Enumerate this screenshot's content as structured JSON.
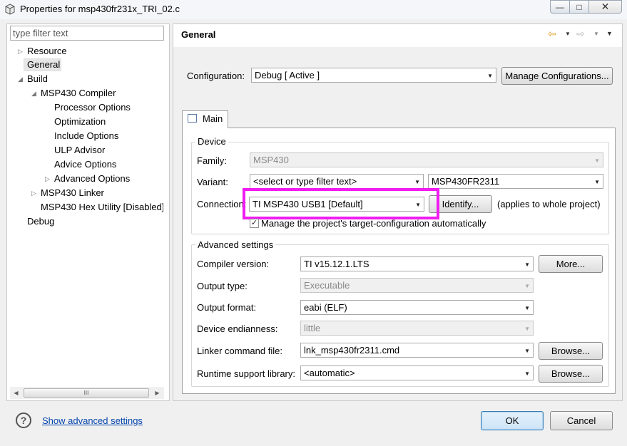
{
  "window": {
    "title": "Properties for msp430fr231x_TRI_02.c",
    "min": "—",
    "max": "□",
    "close": "✕"
  },
  "left": {
    "filter_placeholder": "type filter text",
    "tree": [
      {
        "label": "Resource",
        "arrow": "▷"
      },
      {
        "label": "General"
      },
      {
        "label": "Build",
        "arrow": "◢"
      },
      {
        "label": "MSP430 Compiler",
        "arrow": "◢"
      },
      {
        "label": "Processor Options"
      },
      {
        "label": "Optimization"
      },
      {
        "label": "Include Options"
      },
      {
        "label": "ULP Advisor"
      },
      {
        "label": "Advice Options"
      },
      {
        "label": "Advanced Options",
        "arrow": "▷"
      },
      {
        "label": "MSP430 Linker",
        "arrow": "▷"
      },
      {
        "label": "MSP430 Hex Utility  [Disabled]"
      },
      {
        "label": "Debug"
      }
    ],
    "scroll_thumb": "III"
  },
  "header": {
    "title": "General"
  },
  "config": {
    "label": "Configuration:",
    "value": "Debug  [ Active ]",
    "manage_label": "Manage Configurations..."
  },
  "tab": {
    "label": "Main"
  },
  "device": {
    "group_label": "Device",
    "family_label": "Family:",
    "family_value": "MSP430",
    "variant_label": "Variant:",
    "variant_filter": "<select or type filter text>",
    "variant_value": "MSP430FR2311",
    "connection_label": "Connection:",
    "connection_value": "TI MSP430 USB1 [Default]",
    "identify_label": "Identify...",
    "applies_note": "(applies to whole project)",
    "manage_checkbox_label": "Manage the project's target-configuration automatically",
    "manage_checked": "✓"
  },
  "advanced": {
    "group_label": "Advanced settings",
    "compiler_version_label": "Compiler version:",
    "compiler_version_value": "TI v15.12.1.LTS",
    "more_label": "More...",
    "output_type_label": "Output type:",
    "output_type_value": "Executable",
    "output_format_label": "Output format:",
    "output_format_value": "eabi (ELF)",
    "endianness_label": "Device endianness:",
    "endianness_value": "little",
    "linker_cmd_label": "Linker command file:",
    "linker_cmd_value": "lnk_msp430fr2311.cmd",
    "browse_label": "Browse...",
    "runtime_label": "Runtime support library:",
    "runtime_value": "<automatic>",
    "browse2_label": "Browse..."
  },
  "footer": {
    "help": "?",
    "advanced_link": "Show advanced settings",
    "ok": "OK",
    "cancel": "Cancel"
  },
  "colors": {
    "highlight": "#f01cf0",
    "link": "#0645ad",
    "ok_border": "#3c7fb1"
  },
  "icons": {
    "back": "⇦",
    "forward": "⇨",
    "dropdown": "▼"
  }
}
